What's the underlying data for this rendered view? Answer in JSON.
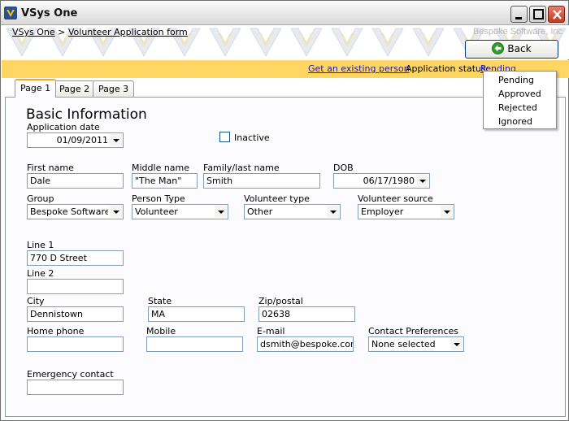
{
  "window": {
    "title": "VSys One"
  },
  "banner": {
    "breadcrumb_home": "VSys One",
    "breadcrumb_sep": ">",
    "breadcrumb_current": "Volunteer Application form",
    "company": "Bespoke Software, Inc",
    "back_label": "Back"
  },
  "status": {
    "existing_link": "Get an existing person",
    "label": "Application status:",
    "value": "Pending",
    "menu": [
      "Pending",
      "Approved",
      "Rejected",
      "Ignored"
    ]
  },
  "tabs": [
    "Page 1",
    "Page 2",
    "Page 3"
  ],
  "form": {
    "section_title": "Basic Information",
    "application_date": {
      "label": "Application date",
      "value": "01/09/2011"
    },
    "inactive": {
      "label": "Inactive",
      "checked": false
    },
    "first_name": {
      "label": "First name",
      "value": "Dale"
    },
    "middle_name": {
      "label": "Middle name",
      "value": "\"The Man\""
    },
    "last_name": {
      "label": "Family/last name",
      "value": "Smith"
    },
    "dob": {
      "label": "DOB",
      "value": "06/17/1980"
    },
    "group": {
      "label": "Group",
      "value": "Bespoke Software, I"
    },
    "person_type": {
      "label": "Person Type",
      "value": "Volunteer"
    },
    "volunteer_type": {
      "label": "Volunteer type",
      "value": "Other"
    },
    "volunteer_source": {
      "label": "Volunteer source",
      "value": "Employer"
    },
    "line1": {
      "label": "Line 1",
      "value": "770 D Street"
    },
    "line2": {
      "label": "Line 2",
      "value": ""
    },
    "city": {
      "label": "City",
      "value": "Dennistown"
    },
    "state": {
      "label": "State",
      "value": "MA"
    },
    "zip": {
      "label": "Zip/postal",
      "value": "02638"
    },
    "home_phone": {
      "label": "Home phone",
      "value": ""
    },
    "mobile": {
      "label": "Mobile",
      "value": ""
    },
    "email": {
      "label": "E-mail",
      "value": "dsmith@bespoke.com"
    },
    "contact_pref": {
      "label": "Contact Preferences",
      "value": "None selected"
    },
    "emergency": {
      "label": "Emergency contact",
      "value": ""
    }
  },
  "colors": {
    "status_bar": "#ffd564",
    "link": "#1a1aaa",
    "tab_accent": "#f5a524"
  }
}
